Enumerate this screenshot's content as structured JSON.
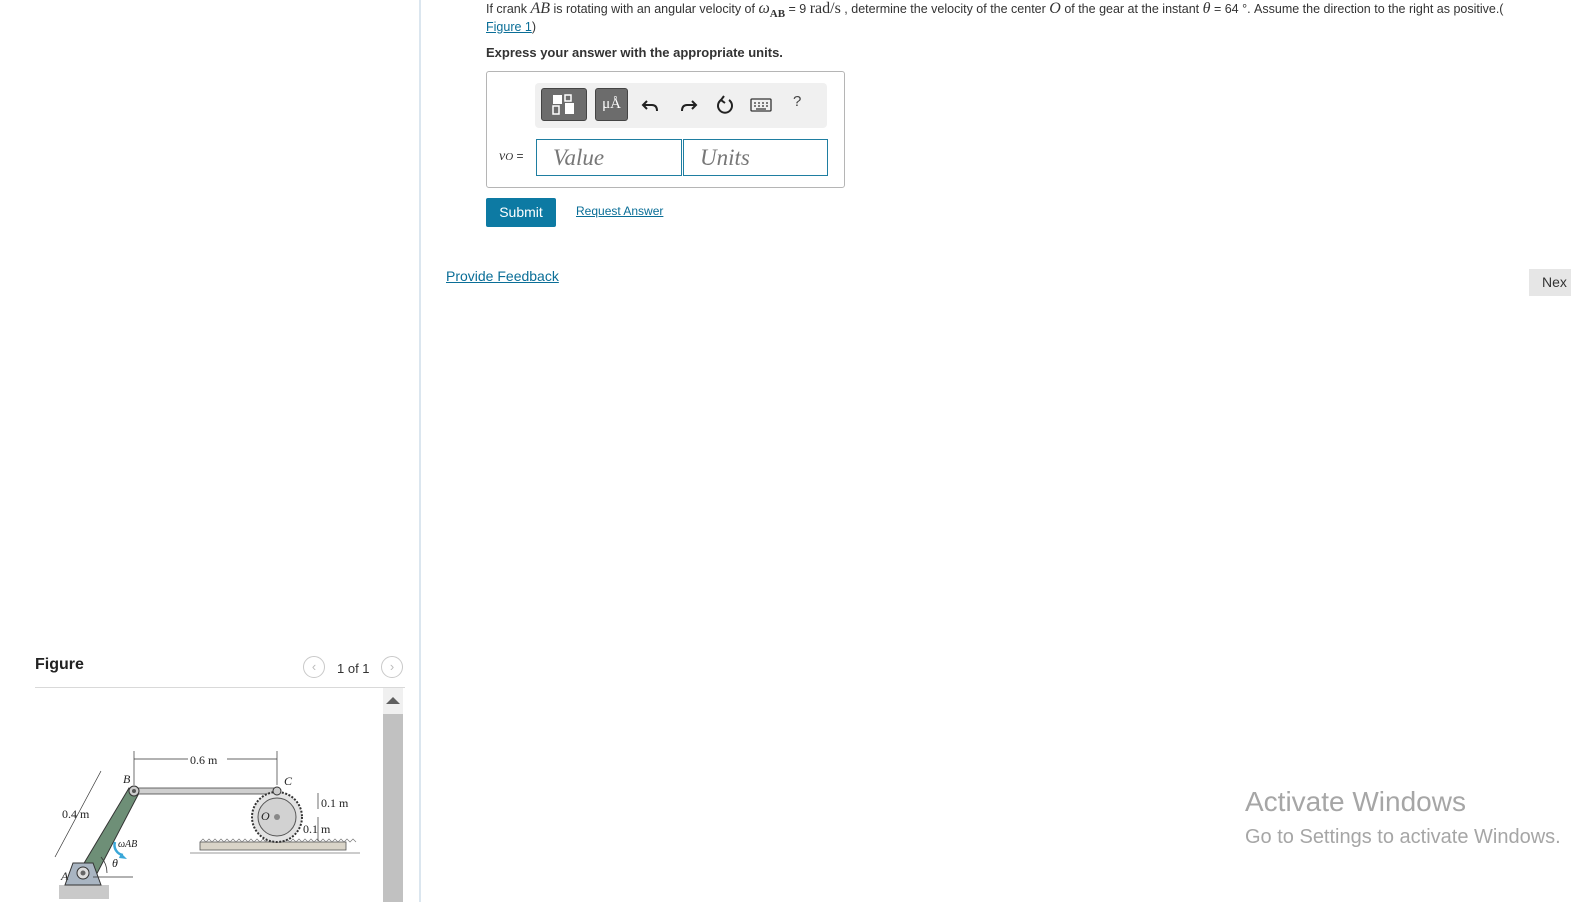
{
  "question": {
    "text_1": "If crank ",
    "crank": "AB",
    "text_2": " is rotating with an angular velocity of ",
    "omega": "ω",
    "omega_sub": "AB",
    "text_3": " = 9 ",
    "rate_unit": "rad/s",
    "text_4": " , determine the velocity of the center ",
    "center": "O",
    "text_5": " of the gear at the instant ",
    "theta": "θ",
    "text_6": " = 64 °. Assume the direction to the right as positive.(",
    "figure_link": "Figure 1",
    "text_7": ")",
    "instruction": "Express your answer with the appropriate units."
  },
  "answer": {
    "variable": "vO",
    "var_v": "v",
    "var_sub": "O",
    "equals": " =",
    "value_placeholder": "Value",
    "units_placeholder": "Units",
    "toolbar_mu": "μÅ",
    "toolbar_help": "?",
    "toolbar_icons": [
      "templates-icon",
      "units-icon",
      "undo-icon",
      "redo-icon",
      "reset-icon",
      "keyboard-icon",
      "help-icon"
    ]
  },
  "buttons": {
    "submit": "Submit",
    "request_answer": "Request Answer",
    "provide_feedback": "Provide Feedback",
    "next": "Nex"
  },
  "figure": {
    "title": "Figure",
    "count": "1 of 1",
    "labels": {
      "dim_top": "0.6 m",
      "dim_left": "0.4 m",
      "dim_right_1": "0.1 m",
      "dim_right_2": "0.1 m",
      "point_a": "A",
      "point_b": "B",
      "point_c": "C",
      "point_o": "O",
      "omega_ab": "ωAB",
      "theta": "θ"
    }
  },
  "watermark": {
    "title": "Activate Windows",
    "subtitle": "Go to Settings to activate Windows."
  },
  "colors": {
    "link": "#0a6e97",
    "submit": "#0d7aa3",
    "crank": "#5f7f6a",
    "accent_arrow": "#3aa7d8"
  }
}
